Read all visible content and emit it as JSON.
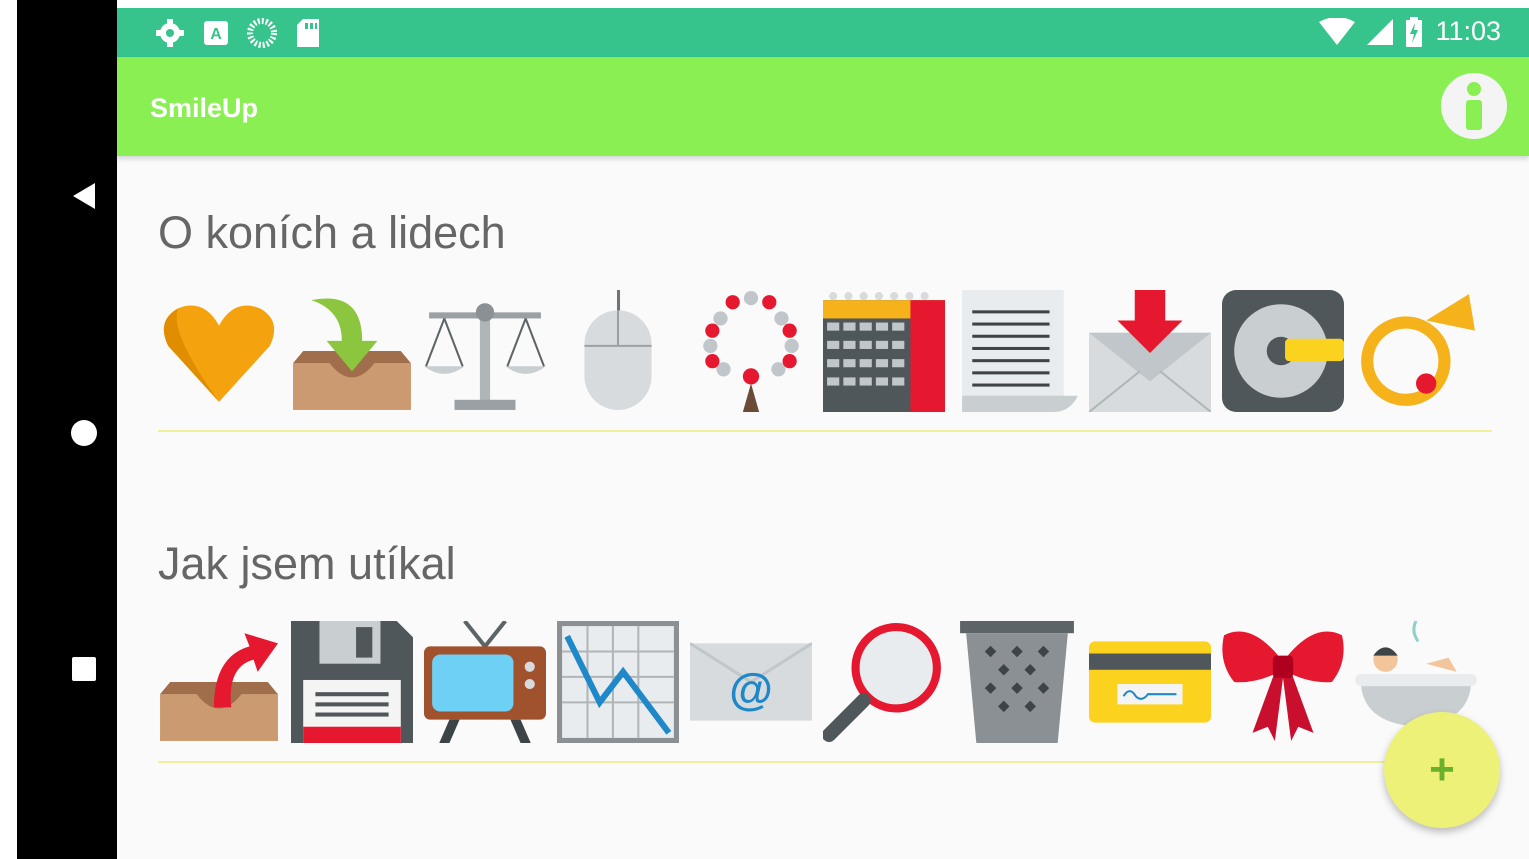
{
  "status_bar": {
    "time": "11:03",
    "left_icons": [
      "settings-icon",
      "a-icon",
      "sync-icon",
      "sd-card-icon"
    ],
    "right_icons": [
      "wifi-icon",
      "signal-icon",
      "battery-charging-icon"
    ]
  },
  "app_bar": {
    "title": "SmileUp",
    "action_icon": "info-icon"
  },
  "sections": [
    {
      "title": "O koních a lidech",
      "emojis": [
        "orange-heart",
        "inbox-tray",
        "balance-scale",
        "computer-mouse",
        "prayer-beads",
        "calendar",
        "page-with-curl",
        "envelope-with-arrow",
        "minidisc",
        "postal-horn"
      ]
    },
    {
      "title": "Jak jsem utíkal",
      "emojis": [
        "outbox-tray",
        "floppy-disk",
        "television",
        "chart-decreasing",
        "email-at",
        "magnifying-glass",
        "wastebasket",
        "credit-card",
        "ribbon-bow",
        "person-in-bath"
      ]
    }
  ],
  "fab": {
    "label": "+"
  },
  "nav": [
    "back-icon",
    "home-icon",
    "recents-icon"
  ],
  "colors": {
    "status": "#37c38c",
    "appbar": "#89ef52",
    "fab": "#eef178",
    "divider": "#f0f09a"
  }
}
